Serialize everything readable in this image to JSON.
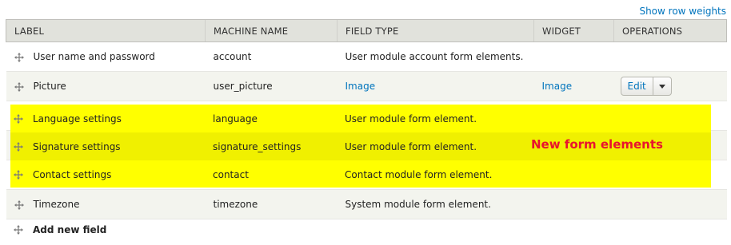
{
  "top_link": "Show row weights",
  "headers": [
    "LABEL",
    "MACHINE NAME",
    "FIELD TYPE",
    "WIDGET",
    "OPERATIONS"
  ],
  "rows": [
    {
      "label": "User name and password",
      "machine": "account",
      "type": "User module account form elements.",
      "widget": "",
      "ops": ""
    },
    {
      "label": "Picture",
      "machine": "user_picture",
      "type": "Image",
      "widget": "Image",
      "ops": "Edit"
    }
  ],
  "highlighted_rows": [
    {
      "label": "Language settings",
      "machine": "language",
      "type": "User module form element."
    },
    {
      "label": "Signature settings",
      "machine": "signature_settings",
      "type": "User module form element."
    },
    {
      "label": "Contact settings",
      "machine": "contact",
      "type": "Contact module form element."
    }
  ],
  "after_rows": [
    {
      "label": "Timezone",
      "machine": "timezone",
      "type": "System module form element."
    }
  ],
  "note": "New form elements",
  "add_label": "Add new field",
  "colors": {
    "link": "#0074bd",
    "highlight": "#ffff00",
    "note": "#e8142e"
  }
}
